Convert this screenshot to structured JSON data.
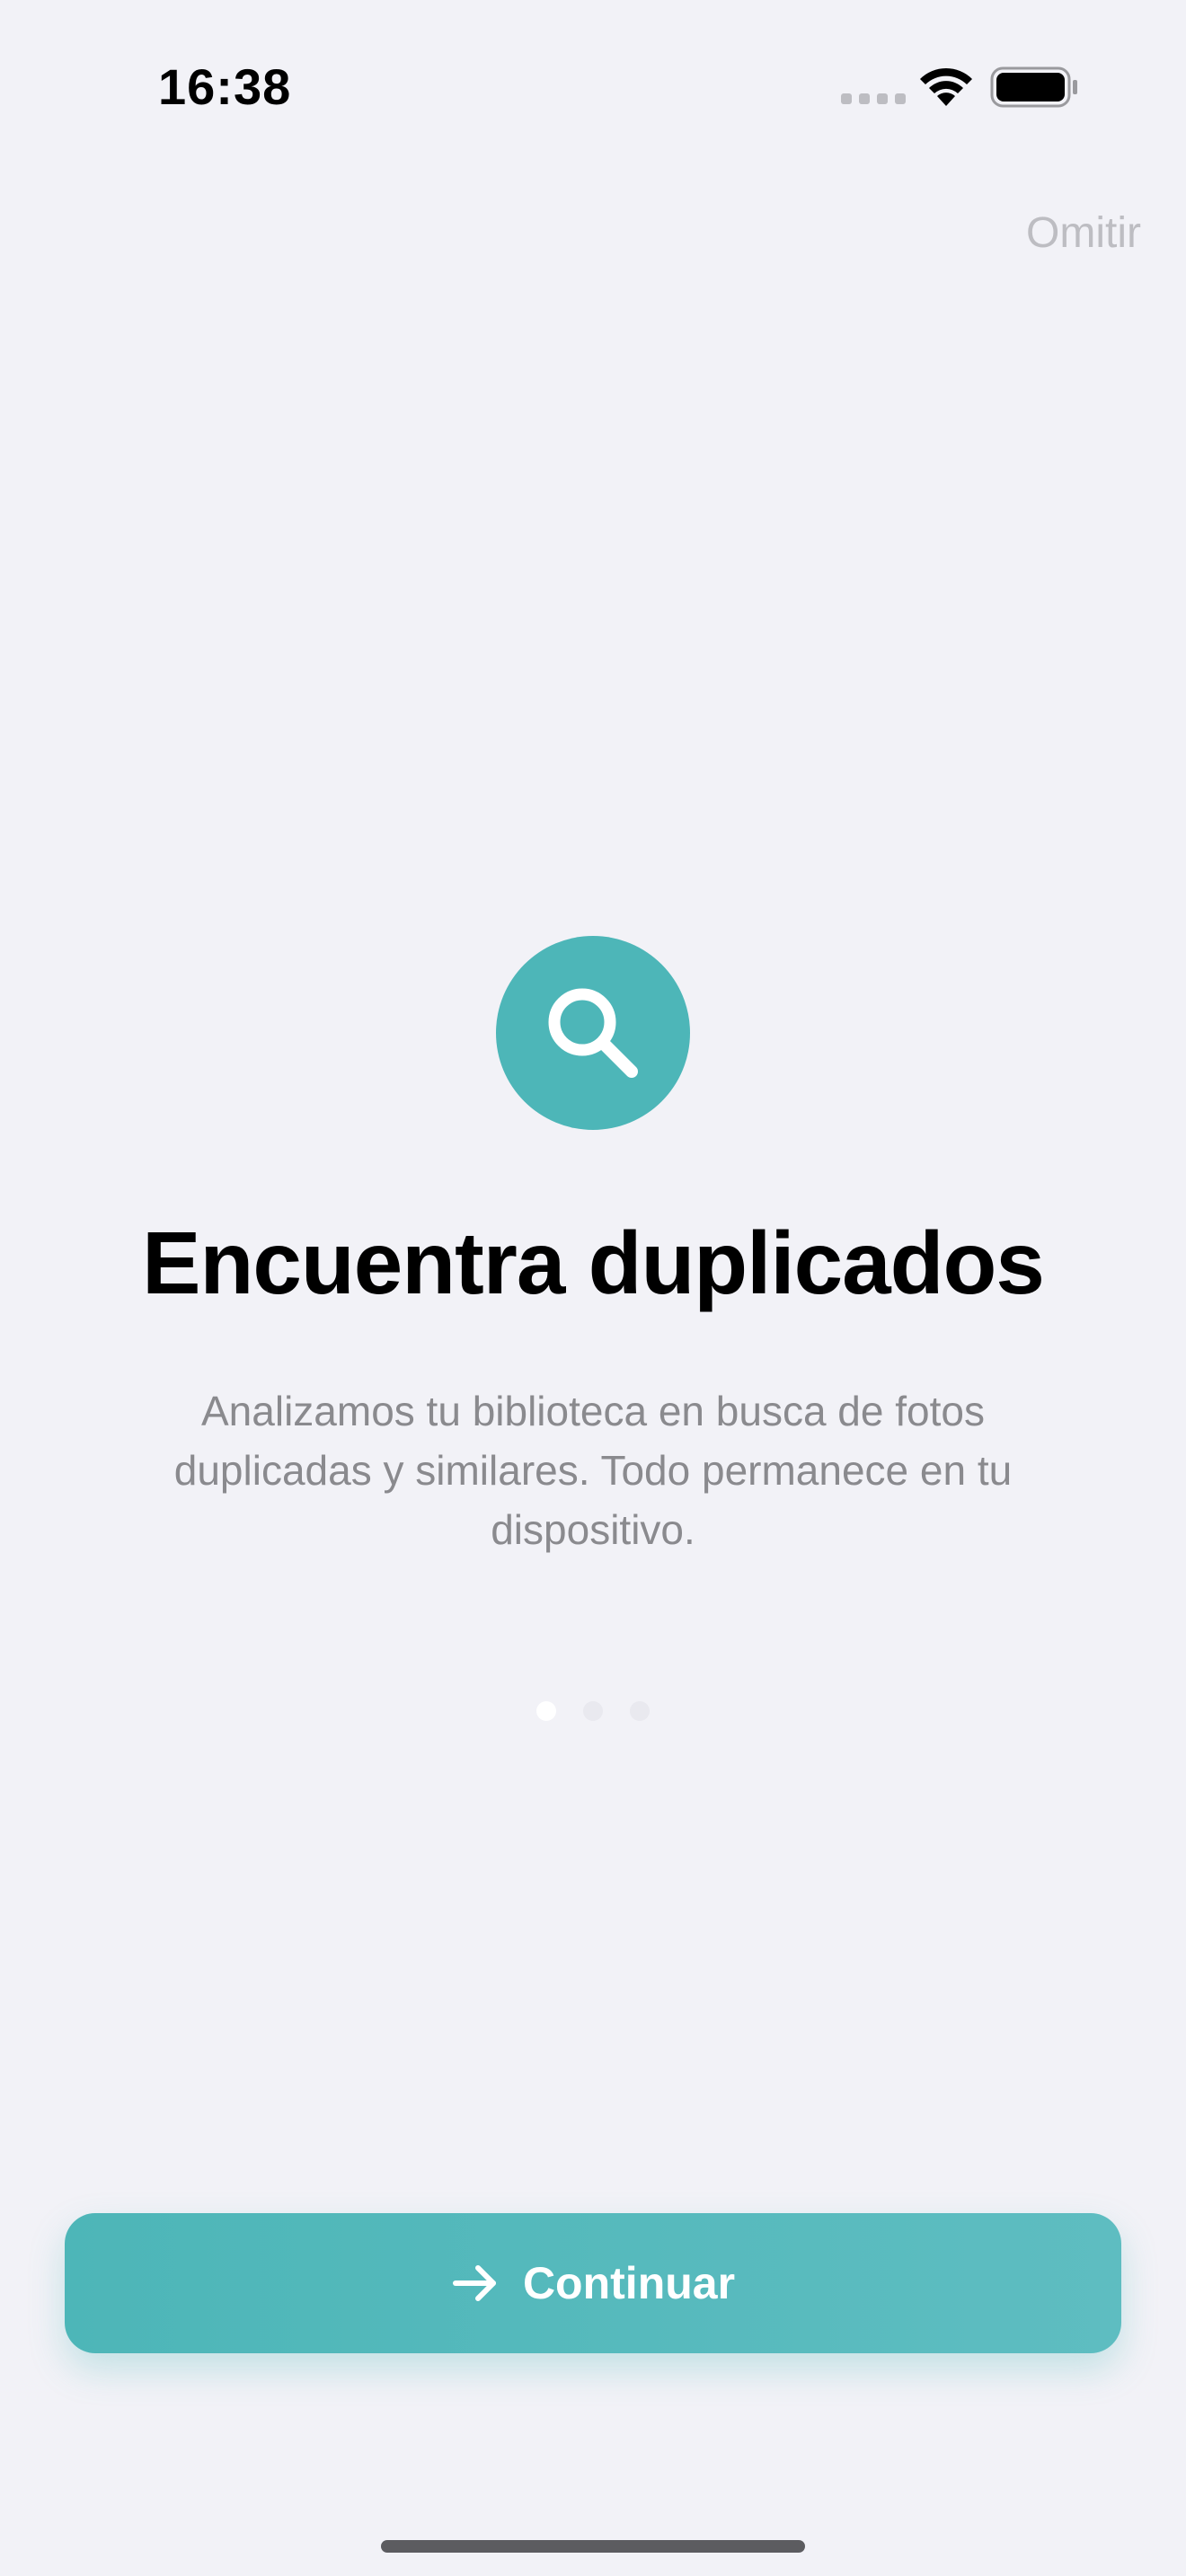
{
  "status_bar": {
    "time": "16:38"
  },
  "header": {
    "skip_label": "Omitir"
  },
  "onboarding": {
    "icon": "search-icon",
    "title": "Encuentra duplicados",
    "description": "Analizamos tu biblioteca en busca de fotos duplicadas y similares. Todo permanece en tu dispositivo.",
    "page_indicator": {
      "current_page": 1,
      "total_pages": 3
    }
  },
  "footer": {
    "continue_label": "Continuar",
    "continue_icon": "arrow-right-icon"
  },
  "colors": {
    "accent": "#4DB6B8",
    "background": "#F2F2F7",
    "secondary_text": "#8A8A8E",
    "skip_text": "#BDBDC2"
  }
}
